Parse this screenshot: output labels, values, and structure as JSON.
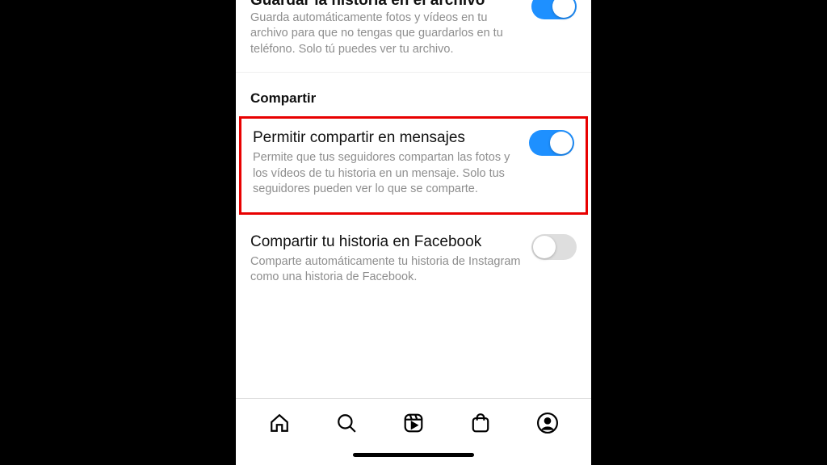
{
  "settings": {
    "archive": {
      "title": "Guardar la historia en el archivo",
      "description": "Guarda automáticamente fotos y vídeos en tu archivo para que no tengas que guardarlos en tu teléfono. Solo tú puedes ver tu archivo.",
      "enabled": true
    },
    "sectionHeader": "Compartir",
    "allowShare": {
      "title": "Permitir compartir en mensajes",
      "description": "Permite que tus seguidores compartan las fotos y los vídeos de tu historia en un mensaje. Solo tus seguidores pueden ver lo que se comparte.",
      "enabled": true
    },
    "shareFacebook": {
      "title": "Compartir tu historia en Facebook",
      "description": "Comparte automáticamente tu historia de Instagram como una historia de Facebook.",
      "enabled": false
    }
  },
  "nav": {
    "home": "home",
    "search": "search",
    "reels": "reels",
    "shop": "shop",
    "profile": "profile"
  }
}
